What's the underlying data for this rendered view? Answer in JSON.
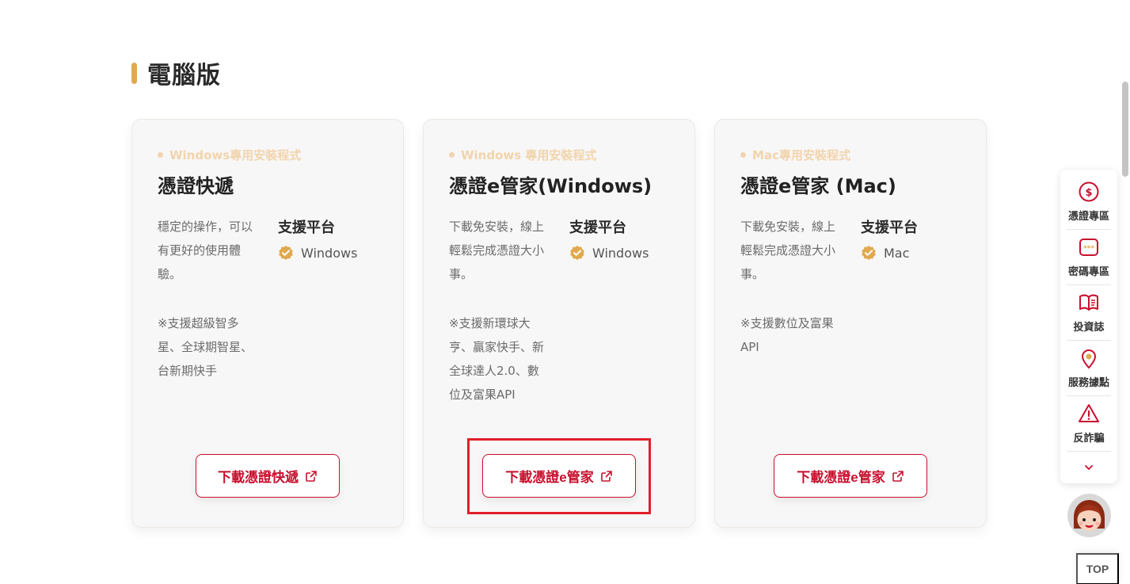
{
  "section": {
    "title": "電腦版"
  },
  "cards": [
    {
      "tag": "Windows專用安裝程式",
      "name": "憑證快遞",
      "desc": "穩定的操作，可以有更好的使用體驗。",
      "note": "※支援超級智多星、全球期智星、台新期快手",
      "platform_title": "支援平台",
      "platform": "Windows",
      "button": "下載憑證快遞"
    },
    {
      "tag": "Windows 專用安裝程式",
      "name": "憑證e管家(Windows)",
      "desc": "下載免安裝，線上輕鬆完成憑證大小事。",
      "note": "※支援新環球大亨、贏家快手、新全球達人2.0、數位及富果API",
      "platform_title": "支援平台",
      "platform": "Windows",
      "button": "下載憑證e管家"
    },
    {
      "tag": "Mac專用安裝程式",
      "name": "憑證e管家 (Mac)",
      "desc": "下載免安裝，線上輕鬆完成憑證大小事。",
      "note": "※支援數位及富果API",
      "platform_title": "支援平台",
      "platform": "Mac",
      "button": "下載憑證e管家"
    }
  ],
  "side_menu": [
    {
      "label": "憑證專區",
      "icon": "dollar-coin-icon"
    },
    {
      "label": "密碼專區",
      "icon": "password-icon"
    },
    {
      "label": "投資誌",
      "icon": "book-icon"
    },
    {
      "label": "服務據點",
      "icon": "location-pin-icon"
    },
    {
      "label": "反詐騙",
      "icon": "warning-icon"
    }
  ],
  "top_button": "TOP",
  "colors": {
    "accent": "#c8102e",
    "gold": "#e0a94f",
    "tag": "#f1d4ad"
  }
}
